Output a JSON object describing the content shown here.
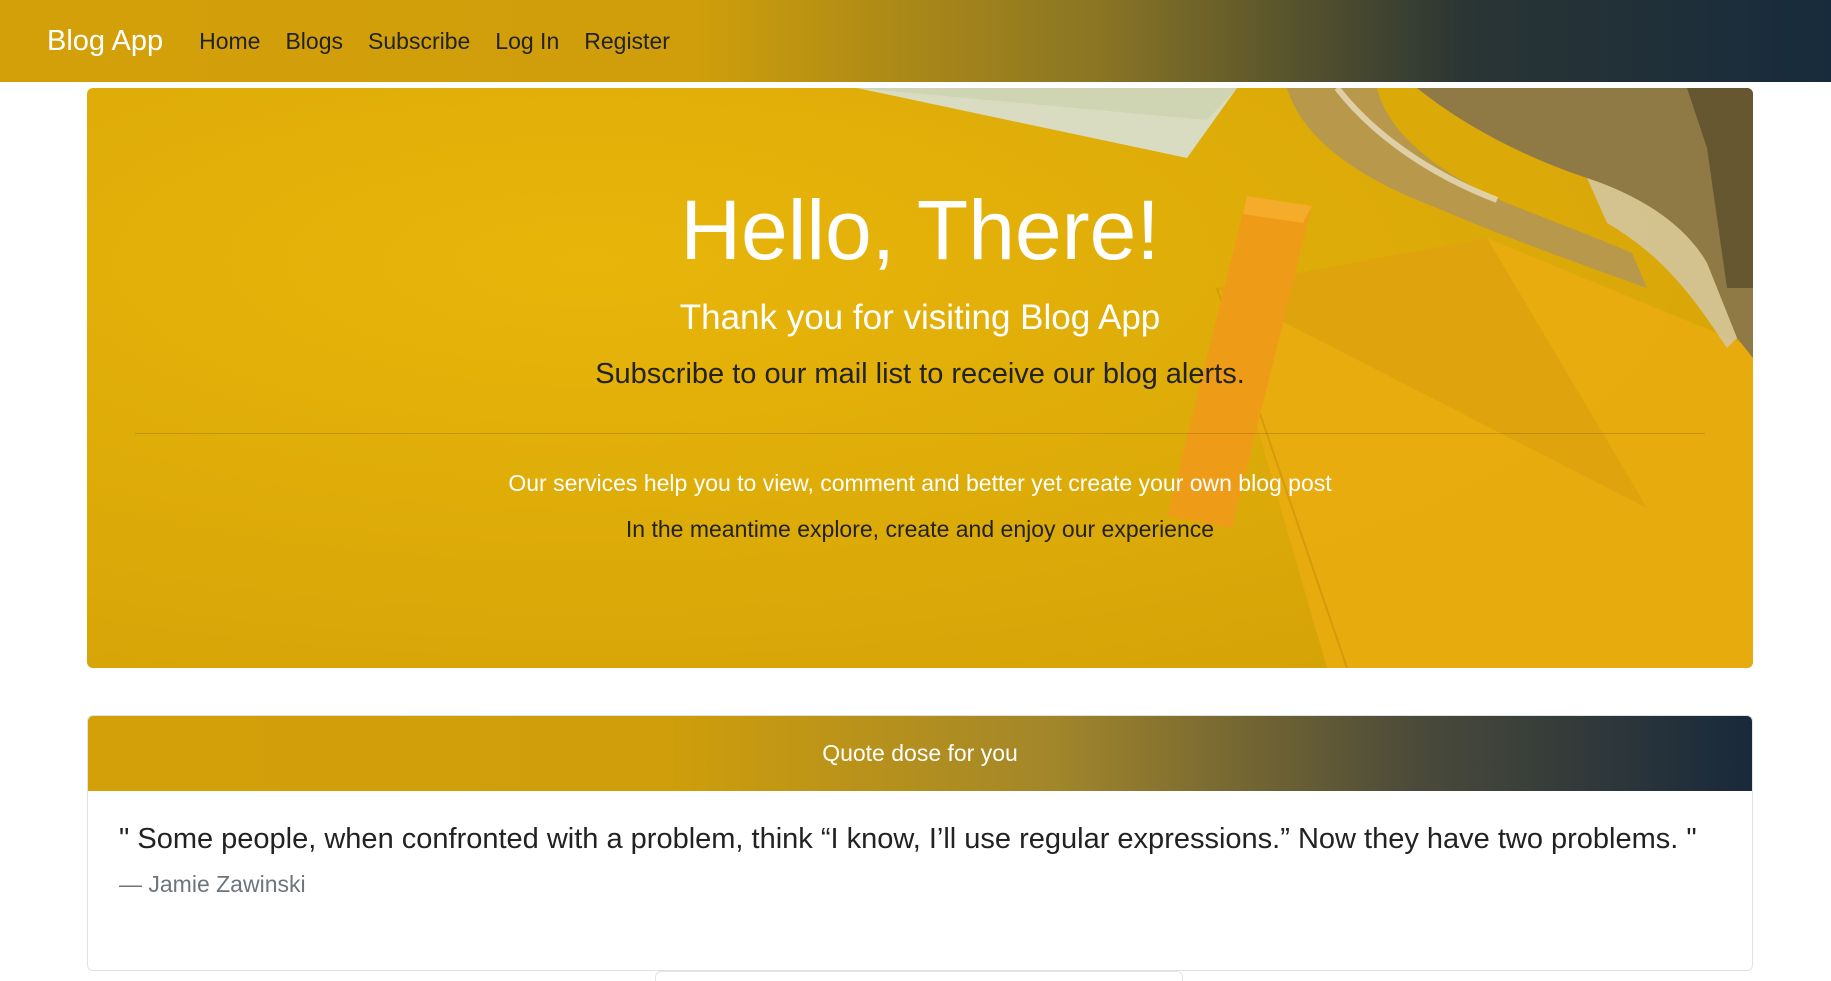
{
  "navbar": {
    "brand": "Blog App",
    "links": [
      "Home",
      "Blogs",
      "Subscribe",
      "Log In",
      "Register"
    ]
  },
  "hero": {
    "title": "Hello, There!",
    "subtitle": "Thank you for visiting Blog App",
    "lead": "Subscribe to our mail list to receive our blog alerts.",
    "services": "Our services help you to view, comment and better yet create your own blog post",
    "explore": "In the meantime explore, create and enjoy our experience"
  },
  "quote": {
    "header": "Quote dose for you",
    "text": "\" Some people, when confronted with a problem, think “I know, I’ll use regular expressions.” Now they have two problems. \"",
    "author": "— Jamie Zawinski"
  },
  "colors": {
    "accent_gold": "#d4a00a",
    "navy": "#172b3d",
    "hero_yellow": "#dcaa08"
  }
}
